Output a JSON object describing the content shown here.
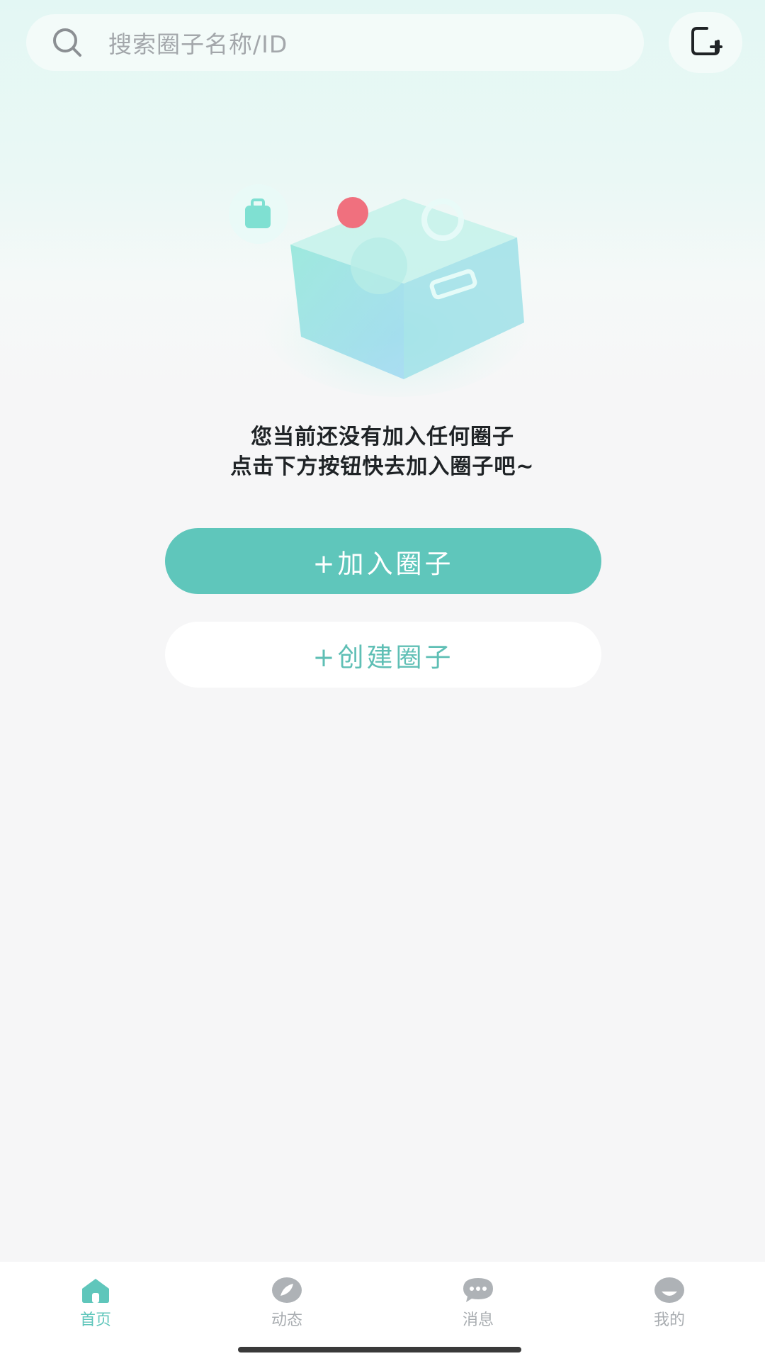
{
  "search": {
    "placeholder": "搜索圈子名称/ID"
  },
  "empty_state": {
    "line1": "您当前还没有加入任何圈子",
    "line2": "点击下方按钮快去加入圈子吧~"
  },
  "actions": {
    "join_label": "+加入圈子",
    "create_label": "+创建圈子"
  },
  "tab_bar": {
    "items": [
      {
        "label": "首页",
        "icon": "home-icon",
        "active": true
      },
      {
        "label": "动态",
        "icon": "leaf-icon",
        "active": false
      },
      {
        "label": "消息",
        "icon": "chat-bubble-icon",
        "active": false
      },
      {
        "label": "我的",
        "icon": "profile-icon",
        "active": false
      }
    ]
  },
  "colors": {
    "accent": "#5fc6bb",
    "tab_inactive": "#a9adb1",
    "page_bg": "#f6f6f7"
  }
}
